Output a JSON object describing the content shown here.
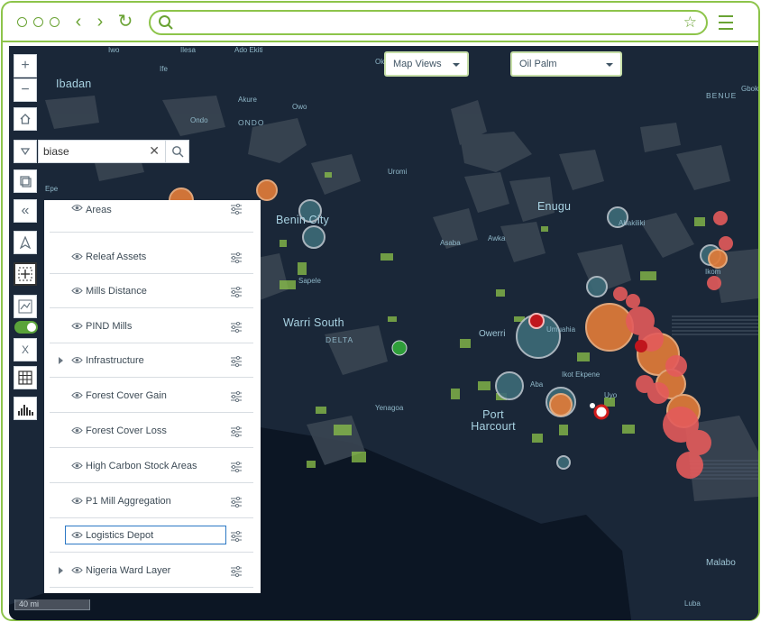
{
  "browser": {
    "url": "",
    "nav": {
      "back": "‹",
      "forward": "›",
      "reload": "↻"
    },
    "icons": [
      "window-dot-icon",
      "search-icon",
      "star-icon",
      "menu-icon"
    ]
  },
  "map": {
    "dropdowns": {
      "map_views": "Map Views",
      "crop": "Oil Palm"
    },
    "search": {
      "value": "biase"
    },
    "toggle_label": "X",
    "scale_label": "40 mi",
    "places": {
      "iwo": "Iwo",
      "ilesa": "Ilesa",
      "ado_ekiti": "Ado Ekiti",
      "ibadan": "Ibadan",
      "ife": "Ife",
      "akure": "Akure",
      "owo": "Owo",
      "ondo_town": "Ondo",
      "ondo": "ONDO",
      "uromi": "Uromi",
      "epe": "Epe",
      "benin_city": "Benin City",
      "asaba": "Asaba",
      "awka": "Awka",
      "enugu": "Enugu",
      "abakiliki": "Abakiliki",
      "ikom": "Ikom",
      "sapele": "Sapele",
      "warri_south": "Warri South",
      "delta": "DELTA",
      "owerri": "Owerri",
      "umuahia": "Umuahia",
      "ikot_ekpene": "Ikot Ekpene",
      "aba": "Aba",
      "uyo": "Uyo",
      "yenagoa": "Yenagoa",
      "port_harcourt": "Port Harcourt",
      "malabo": "Malabo",
      "luba": "Luba",
      "benue": "BENUE",
      "gboko": "Gbok",
      "ok": "Ok"
    }
  },
  "layers": [
    {
      "label": "Deforestation Protected Areas",
      "expandable": false
    },
    {
      "label": "Releaf Assets",
      "expandable": false
    },
    {
      "label": "Mills Distance",
      "expandable": false
    },
    {
      "label": "PIND Mills",
      "expandable": false
    },
    {
      "label": "Infrastructure",
      "expandable": true
    },
    {
      "label": "Forest Cover Gain",
      "expandable": false
    },
    {
      "label": "Forest Cover Loss",
      "expandable": false
    },
    {
      "label": "High Carbon Stock Areas",
      "expandable": false
    },
    {
      "label": "P1 Mill Aggregation",
      "expandable": false
    },
    {
      "label": "Logistics Depot",
      "expandable": false
    },
    {
      "label": "Nigeria Ward Layer",
      "expandable": true
    }
  ],
  "colors": {
    "accent": "#8dc44a",
    "map_bg": "#0f1a2a",
    "marker_orange": "#e07b39",
    "marker_red": "#e35b5b",
    "marker_teal": "#3d6b78",
    "focus": "#2b78c4"
  }
}
